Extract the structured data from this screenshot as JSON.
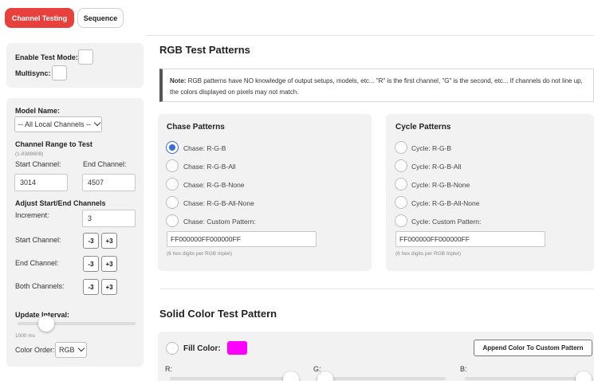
{
  "tabs": [
    {
      "label": "Channel Testing",
      "active": true
    },
    {
      "label": "Sequence",
      "active": false
    }
  ],
  "test_mode": {
    "enable_label": "Enable Test Mode:",
    "multisync_label": "Multisync:"
  },
  "model": {
    "label": "Model Name:",
    "selected": "-- All Local Channels --",
    "range_title": "Channel Range to Test",
    "range_hint": "(1-8388608)",
    "start_label": "Start Channel:",
    "end_label": "End Channel:",
    "start_value": "3014",
    "end_value": "4507"
  },
  "adjust": {
    "title": "Adjust Start/End Channels",
    "increment_label": "Increment:",
    "increment_value": "3",
    "start_label": "Start Channel:",
    "end_label": "End Channel:",
    "both_label": "Both Channels:",
    "minus": "-3",
    "plus": "+3"
  },
  "update": {
    "label": "Update Interval:",
    "value": "1000 ms",
    "slider_fraction": 0.2
  },
  "color_order": {
    "label": "Color Order:",
    "selected": "RGB"
  },
  "rgb": {
    "title": "RGB Test Patterns",
    "note_bold": "Note:",
    "note_text": " RGB patterns have NO knowledge of output setups, models, etc... \"R\" is the first channel, \"G\" is the second, etc... If channels do not line up, the colors displayed on pixels may not match."
  },
  "chase": {
    "title": "Chase Patterns",
    "options": [
      "Chase: R-G-B",
      "Chase: R-G-B-All",
      "Chase: R-G-B-None",
      "Chase: R-G-B-All-None",
      "Chase: Custom Pattern:"
    ],
    "selected_index": 0,
    "custom_value": "FF000000FF000000FF",
    "hint": "(6 hex digits per RGB triplet)"
  },
  "cycle": {
    "title": "Cycle Patterns",
    "options": [
      "Cycle: R-G-B",
      "Cycle: R-G-B-All",
      "Cycle: R-G-B-None",
      "Cycle: R-G-B-All-None",
      "Cycle: Custom Pattern:"
    ],
    "selected_index": -1,
    "custom_value": "FF000000FF000000FF",
    "hint": "(6 hex digits per RGB triplet)"
  },
  "solid": {
    "title": "Solid Color Test Pattern",
    "fill_label": "Fill Color:",
    "fill_color": "#ff00ff",
    "append_label": "Append Color To Custom Pattern",
    "r_label": "R:",
    "g_label": "G:",
    "b_label": "B:"
  },
  "colors": {
    "accent": "#e8413d",
    "radio_selected": "#3b6fd6",
    "panel_bg": "#f2f2f2"
  }
}
